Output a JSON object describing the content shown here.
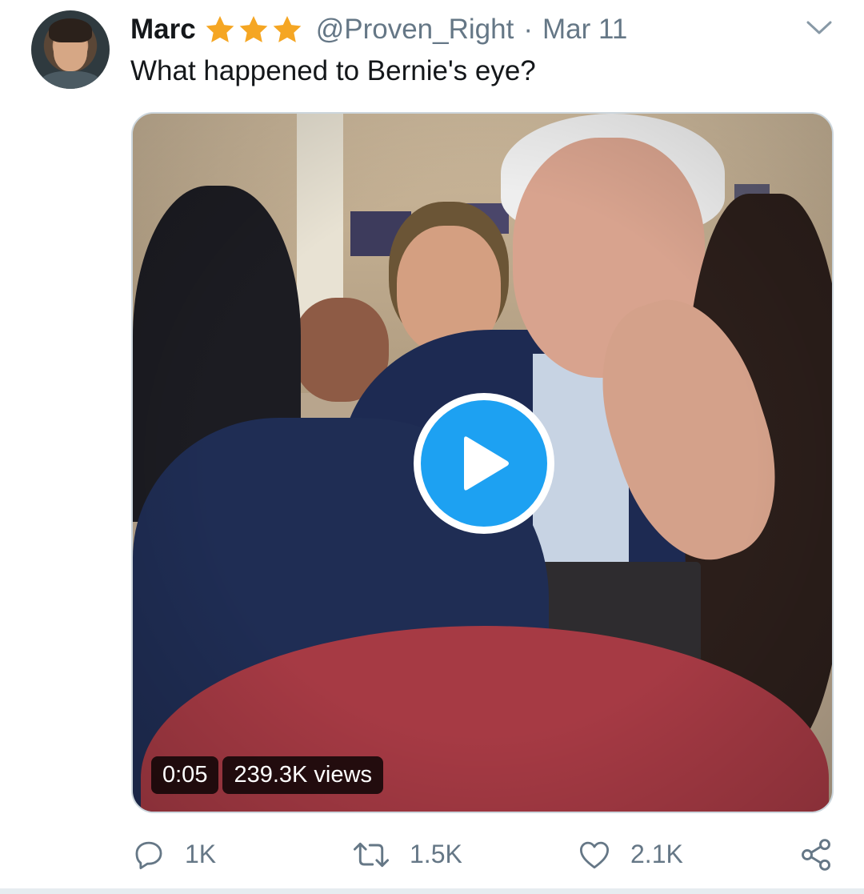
{
  "tweet": {
    "name": "Marc",
    "handle": "@Proven_Right",
    "separator": "·",
    "date": "Mar 11",
    "text": "What happened to Bernie's eye?",
    "star_count": 3,
    "star_color": "#f5a623"
  },
  "media": {
    "duration": "0:05",
    "views": "239.3K views",
    "play_color": "#1da1f2"
  },
  "actions": {
    "replies": "1K",
    "retweets": "1.5K",
    "likes": "2.1K",
    "icons": [
      "reply-icon",
      "retweet-icon",
      "like-icon",
      "share-icon"
    ]
  },
  "colors": {
    "text": "#14171a",
    "secondary": "#657786",
    "border": "#ccd6dd",
    "accent": "#1da1f2"
  }
}
